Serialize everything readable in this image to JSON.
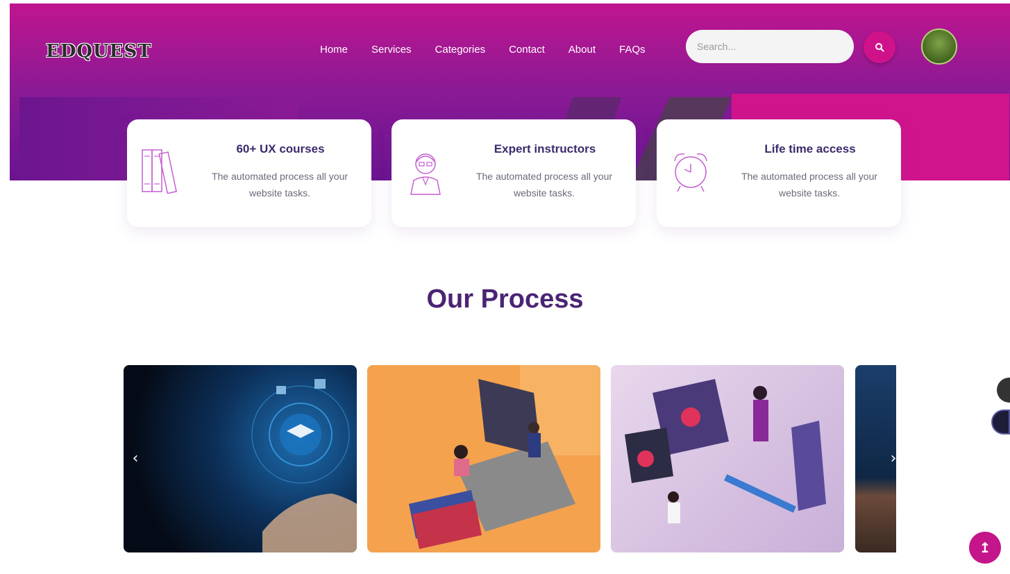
{
  "brand": {
    "logo_text": "EDQUEST"
  },
  "nav": {
    "items": [
      {
        "label": "Home"
      },
      {
        "label": "Services"
      },
      {
        "label": "Categories"
      },
      {
        "label": "Contact"
      },
      {
        "label": "About"
      },
      {
        "label": "FAQs"
      }
    ]
  },
  "search": {
    "placeholder": "Search..."
  },
  "features": [
    {
      "icon": "books-icon",
      "title": "60+ UX courses",
      "description": "The automated process all your website tasks."
    },
    {
      "icon": "instructor-icon",
      "title": "Expert instructors",
      "description": "The automated process all your website tasks."
    },
    {
      "icon": "alarm-clock-icon",
      "title": "Life time access",
      "description": "The automated process all your website tasks."
    }
  ],
  "process": {
    "title": "Our Process"
  },
  "carousel": {
    "prev_label": "‹",
    "next_label": "›"
  },
  "scroll_top": {
    "label": "↥"
  },
  "colors": {
    "accent": "#c4168a",
    "hero_top": "#c0158f",
    "hero_bottom": "#6a1490",
    "heading": "#4b2474"
  }
}
